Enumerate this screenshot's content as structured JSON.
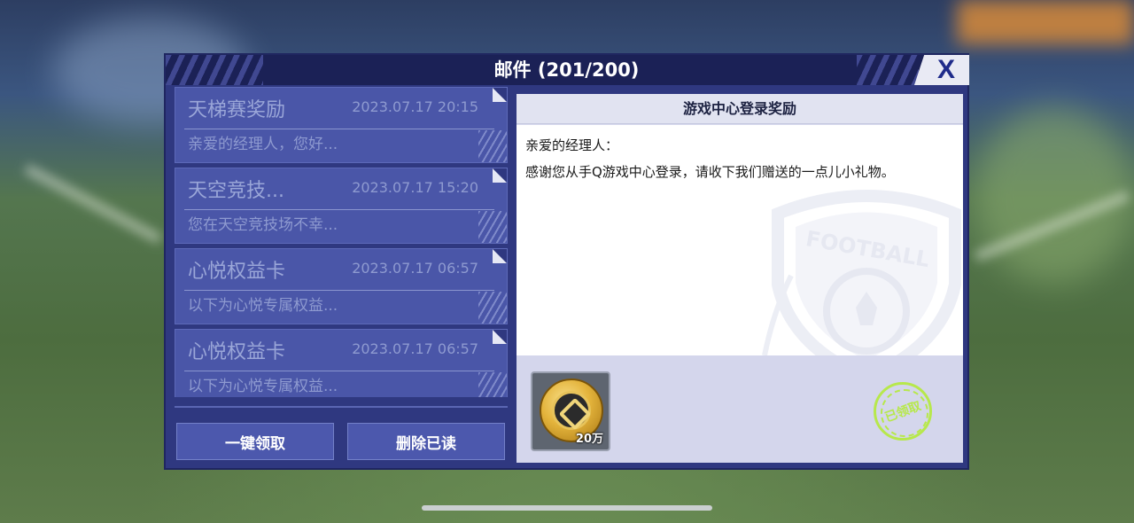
{
  "window": {
    "title": "邮件 (201/200)",
    "close_label": "X"
  },
  "mail_list": [
    {
      "subject": "天梯赛奖励",
      "date": "2023.07.17 20:15",
      "preview": "亲爱的经理人，您好..."
    },
    {
      "subject": "天空竞技...",
      "date": "2023.07.17 15:20",
      "preview": "您在天空竞技场不幸..."
    },
    {
      "subject": "心悦权益卡",
      "date": "2023.07.17 06:57",
      "preview": "以下为心悦专属权益..."
    },
    {
      "subject": "心悦权益卡",
      "date": "2023.07.17 06:57",
      "preview": "以下为心悦专属权益..."
    }
  ],
  "buttons": {
    "claim_all": "一键领取",
    "delete_read": "删除已读"
  },
  "detail": {
    "title": "游戏中心登录奖励",
    "greeting": "亲爱的经理人：",
    "body": "感谢您从手Q游戏中心登录，请收下我们赠送的一点儿小礼物。",
    "emblem_text": "FOOTBALL",
    "reward": {
      "icon": "gold-coin-icon",
      "count": "20万"
    },
    "status_stamp": "已领取"
  },
  "colors": {
    "panel": "#2f3880",
    "title_bar": "#1b2156",
    "stamp": "#b7e84c"
  }
}
